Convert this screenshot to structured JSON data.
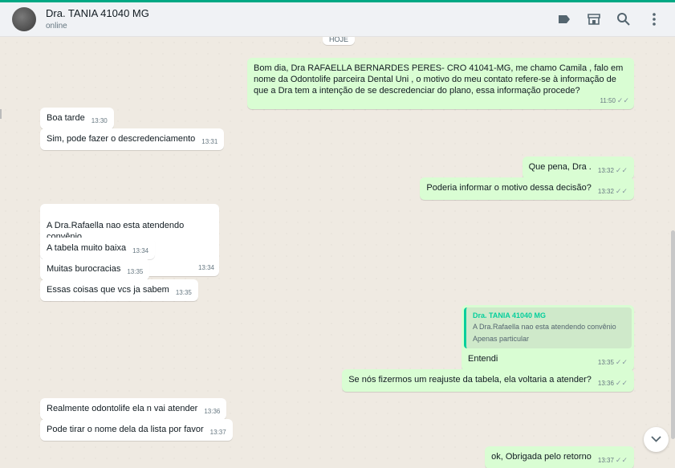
{
  "header": {
    "contact_name": "Dra. TANIA 41040 MG",
    "status": "online"
  },
  "date_label": "HOJE",
  "messages": [
    {
      "dir": "out",
      "text": "Bom dia, Dra RAFAELLA BERNARDES PERES- CRO 41041-MG, me chamo Camila , falo em nome da Odontolife parceira Dental Uni , o motivo do meu contato refere-se à informação de que a Dra tem a intenção de se descredenciar do plano, essa informação procede?",
      "time": "11:50"
    },
    {
      "dir": "in",
      "text": "Boa tarde",
      "time": "13:30"
    },
    {
      "dir": "in",
      "text": "Sim, pode fazer o descredenciamento",
      "time": "13:31"
    },
    {
      "dir": "out",
      "text": "Que pena, Dra .",
      "time": "13:32"
    },
    {
      "dir": "out",
      "text": "Poderia informar o motivo dessa decisão?",
      "time": "13:32"
    },
    {
      "dir": "in",
      "text": "A Dra.Rafaella nao esta atendendo convênio\nApenas particular",
      "time": "13:34"
    },
    {
      "dir": "in",
      "text": "A tabela muito baixa",
      "time": "13:34"
    },
    {
      "dir": "in",
      "text": "Muitas burocracias",
      "time": "13:35"
    },
    {
      "dir": "in",
      "text": "Essas coisas que vcs ja sabem",
      "time": "13:35"
    },
    {
      "dir": "out",
      "text": "Entendi",
      "time": "13:35",
      "quote_author": "Dra. TANIA 41040 MG",
      "quote_text": "A Dra.Rafaella nao esta atendendo convênio\nApenas particular"
    },
    {
      "dir": "out",
      "text": "Se nós fizermos um reajuste da tabela, ela voltaria a atender?",
      "time": "13:36"
    },
    {
      "dir": "in",
      "text": "Realmente odontolife ela n vai atender",
      "time": "13:36"
    },
    {
      "dir": "in",
      "text": "Pode tirar o nome dela da lista por favor",
      "time": "13:37"
    },
    {
      "dir": "out",
      "text": "ok, Obrigada pelo retorno",
      "time": "13:37"
    }
  ],
  "colors": {
    "accent": "#00a884",
    "outgoing": "#d9fdd3",
    "incoming": "#ffffff",
    "background": "#efeae2"
  },
  "icons": [
    "label-icon",
    "catalog-icon",
    "search-icon",
    "menu-icon",
    "chevron-down-icon"
  ]
}
